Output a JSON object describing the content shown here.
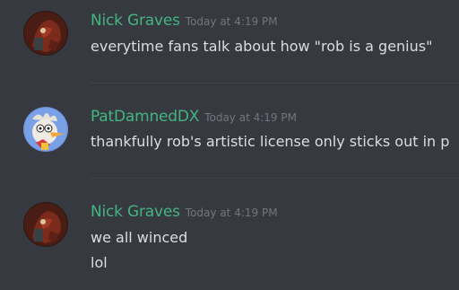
{
  "colors": {
    "background": "#36393f",
    "username_nick": "#43b581",
    "username_pat": "#43b581",
    "timestamp": "#72767d",
    "message_text": "#dcddde"
  },
  "messages": [
    {
      "author": "Nick Graves",
      "timestamp": "Today at 4:19 PM",
      "lines": [
        "everytime fans talk about how \"rob is a genius\""
      ],
      "avatar_icon": "dark-red-creature-avatar"
    },
    {
      "author": "PatDamnedDX",
      "timestamp": "Today at 4:19 PM",
      "lines": [
        "thankfully rob's artistic license only sticks out in p"
      ],
      "avatar_icon": "cartoon-bird-avatar"
    },
    {
      "author": "Nick Graves",
      "timestamp": "Today at 4:19 PM",
      "lines": [
        "we all winced",
        "lol"
      ],
      "avatar_icon": "dark-red-creature-avatar"
    }
  ]
}
